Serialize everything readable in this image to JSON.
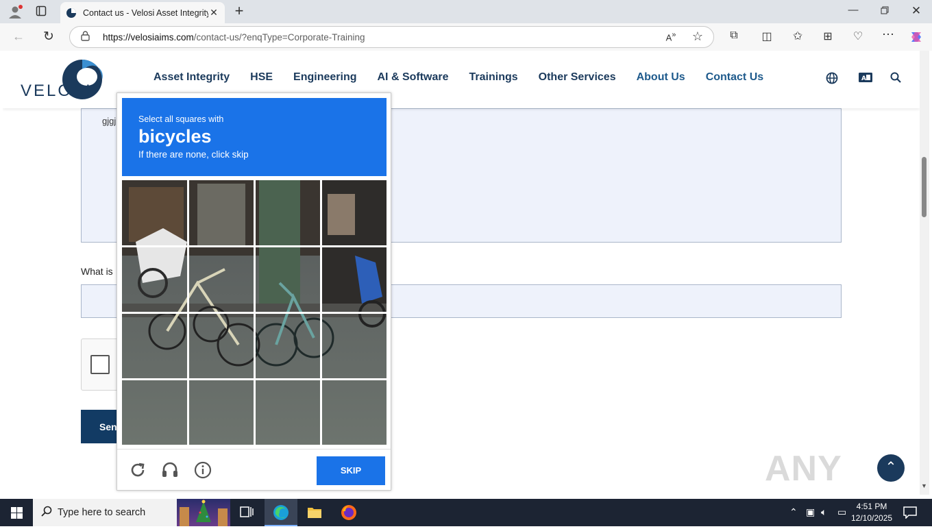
{
  "browser": {
    "tab_title": "Contact us - Velosi Asset Integrity",
    "url_host": "https://velosiaims.com",
    "url_path": "/contact-us/?enqType=Corporate-Training"
  },
  "site": {
    "logo_text": "VELOSI",
    "nav": [
      "Asset Integrity",
      "HSE",
      "Engineering",
      "AI & Software",
      "Trainings",
      "Other Services",
      "About Us",
      "Contact Us"
    ]
  },
  "form": {
    "message_value": "gjgj",
    "question_label": "What is",
    "send_label": "Sen"
  },
  "captcha": {
    "instruction": "Select all squares with",
    "target": "bicycles",
    "hint": "If there are none, click skip",
    "skip_label": "SKIP"
  },
  "watermark": "ANY RUN",
  "taskbar": {
    "search_placeholder": "Type here to search",
    "time": "4:51 PM",
    "date": "12/10/2025"
  }
}
